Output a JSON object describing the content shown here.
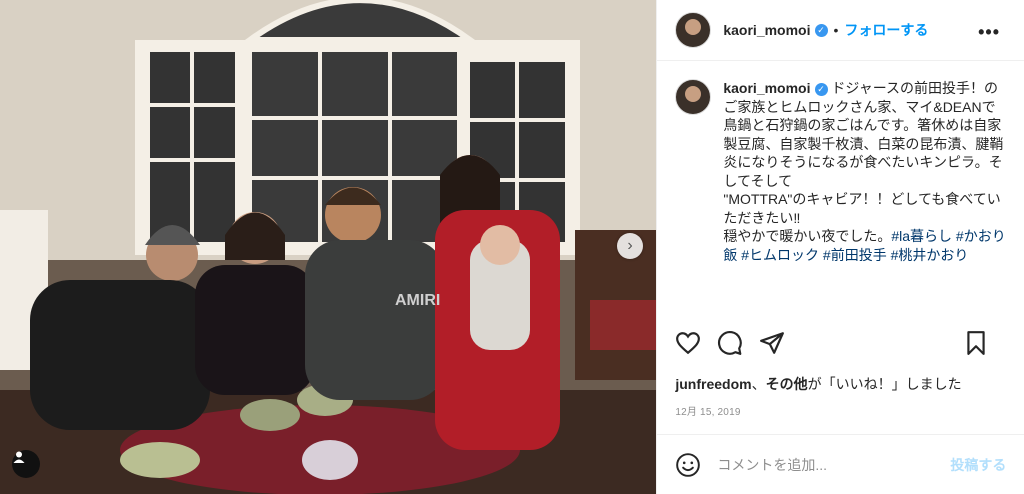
{
  "header": {
    "username": "kaori_momoi",
    "verified_mark": "✓",
    "separator": "•",
    "follow_label": "フォローする",
    "more_label": "•••"
  },
  "caption": {
    "username": "kaori_momoi",
    "text": " ドジャースの前田投手！のご家族とヒムロックさん家、マイ&DEANで鳥鍋と石狩鍋の家ごはんです。箸休めは自家製豆腐、自家製千枚漬、白菜の昆布漬、腱鞘炎になりそうになるが食べたいキンピラ。そしてそして",
    "line2": "\"MOTTRA\"のキャビア！！どしても食べていただきたい‼",
    "line3": "穏やかで暖かい夜でした。",
    "hashtags": "#la暮らし #かおり飯 #ヒムロック #前田投手 #桃井かおり"
  },
  "photo": {
    "shirt_text": "AMIRI",
    "next_icon": "›"
  },
  "actions": {
    "like_icon": "heart-icon",
    "comment_icon": "comment-icon",
    "share_icon": "share-icon",
    "save_icon": "bookmark-icon"
  },
  "likes": {
    "user": "junfreedom",
    "sep": "、",
    "others": "その他",
    "suffix": "が「いいね！」しました"
  },
  "date": "12月 15, 2019",
  "comment": {
    "emoji_icon": "smiley-icon",
    "placeholder": "コメントを追加...",
    "post_label": "投稿する"
  }
}
